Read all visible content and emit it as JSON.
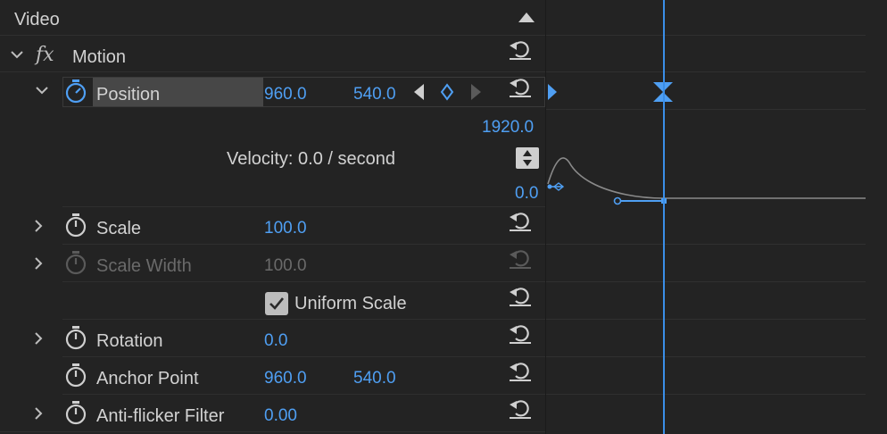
{
  "section": {
    "title": "Video"
  },
  "effect": {
    "name": "Motion",
    "fx_symbol": "fx"
  },
  "properties": {
    "position": {
      "label": "Position",
      "x": "960.0",
      "y": "540.0"
    },
    "velocity": {
      "max": "1920.0",
      "text": "Velocity: 0.0 / second",
      "min": "0.0"
    },
    "scale": {
      "label": "Scale",
      "value": "100.0"
    },
    "scale_width": {
      "label": "Scale Width",
      "value": "100.0"
    },
    "uniform_scale": {
      "label": "Uniform Scale",
      "checked": true
    },
    "rotation": {
      "label": "Rotation",
      "value": "0.0"
    },
    "anchor_point": {
      "label": "Anchor Point",
      "x": "960.0",
      "y": "540.0"
    },
    "anti_flicker": {
      "label": "Anti-flicker Filter",
      "value": "0.00"
    }
  },
  "colors": {
    "accent": "#4f9ff3",
    "background": "#232323",
    "text": "#d2d2d2",
    "disabled": "#6a6a6a"
  },
  "icons": [
    "collapse-triangle-icon",
    "chevron-down-icon",
    "chevron-right-icon",
    "stopwatch-icon",
    "reset-icon",
    "keyframe-prev-icon",
    "keyframe-add-icon",
    "keyframe-next-icon",
    "checkbox-icon",
    "sort-icon"
  ]
}
